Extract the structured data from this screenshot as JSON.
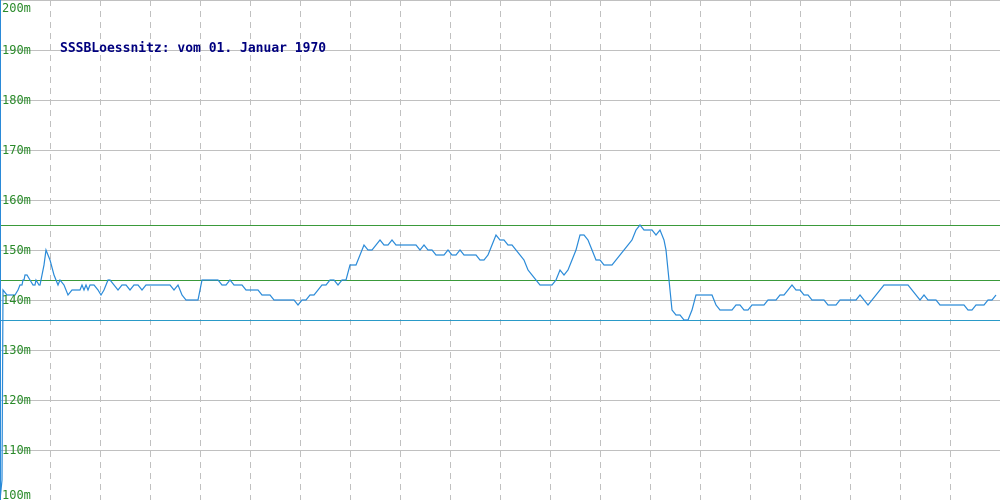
{
  "chart_data": {
    "type": "line",
    "title": "SSSBLoessnitz: vom 01. Januar 1970",
    "xlabel": "",
    "ylabel": "",
    "ylim": [
      100,
      200
    ],
    "yticks": [
      100,
      110,
      120,
      130,
      140,
      150,
      160,
      170,
      180,
      190,
      200
    ],
    "ytick_labels": [
      "100m",
      "110m",
      "120m",
      "130m",
      "140m",
      "150m",
      "160m",
      "170m",
      "180m",
      "190m",
      "200m"
    ],
    "grid": true,
    "x": [
      0,
      2,
      3,
      7,
      9,
      10,
      15,
      18,
      20,
      22,
      23,
      24,
      25,
      27,
      30,
      33,
      35,
      36,
      39,
      40,
      42,
      44,
      46,
      50,
      54,
      58,
      60,
      64,
      68,
      72,
      74,
      76,
      78,
      80,
      82,
      84,
      86,
      88,
      90,
      94,
      98,
      101,
      104,
      108,
      110,
      114,
      118,
      122,
      126,
      130,
      134,
      138,
      142,
      146,
      150,
      154,
      158,
      162,
      166,
      170,
      174,
      178,
      180,
      182,
      186,
      190,
      194,
      198,
      202,
      206,
      210,
      214,
      218,
      222,
      226,
      230,
      234,
      238,
      242,
      246,
      250,
      254,
      258,
      262,
      266,
      270,
      274,
      278,
      282,
      286,
      290,
      294,
      298,
      302,
      306,
      310,
      314,
      318,
      322,
      326,
      330,
      334,
      338,
      342,
      346,
      350,
      352,
      356,
      360,
      364,
      368,
      372,
      376,
      380,
      384,
      388,
      392,
      396,
      400,
      404,
      408,
      412,
      416,
      420,
      424,
      428,
      432,
      436,
      440,
      444,
      448,
      452,
      456,
      460,
      464,
      468,
      472,
      476,
      480,
      484,
      488,
      492,
      496,
      500,
      504,
      508,
      512,
      516,
      520,
      524,
      528,
      532,
      536,
      540,
      544,
      548,
      552,
      556,
      560,
      564,
      568,
      572,
      576,
      580,
      584,
      588,
      592,
      596,
      600,
      604,
      608,
      612,
      616,
      620,
      624,
      628,
      632,
      636,
      640,
      644,
      648,
      652,
      656,
      660,
      664,
      666,
      668,
      670,
      672,
      676,
      680,
      684,
      688,
      692,
      696,
      700,
      704,
      708,
      712,
      716,
      720,
      724,
      728,
      732,
      736,
      740,
      744,
      748,
      752,
      756,
      760,
      764,
      768,
      772,
      776,
      780,
      784,
      788,
      792,
      796,
      800,
      804,
      808,
      812,
      816,
      820,
      824,
      828,
      832,
      836,
      840,
      844,
      848,
      852,
      856,
      860,
      864,
      868,
      872,
      876,
      880,
      884,
      888,
      892,
      896,
      900,
      904,
      908,
      912,
      916,
      920,
      924,
      928,
      932,
      936,
      940,
      944,
      948,
      952,
      956,
      960,
      964,
      968,
      972,
      976,
      980,
      984,
      988,
      992,
      996
    ],
    "series": [
      {
        "values": [
          100,
          104,
          142,
          141,
          141,
          141,
          141,
          142,
          143,
          143,
          144,
          144,
          145,
          145,
          144,
          143,
          143,
          144,
          143,
          143,
          145,
          147,
          150,
          148,
          145,
          143,
          144,
          143,
          141,
          142,
          142,
          142,
          142,
          142,
          143,
          142,
          143,
          142,
          143,
          143,
          142,
          141,
          142,
          144,
          144,
          143,
          142,
          143,
          143,
          142,
          143,
          143,
          142,
          143,
          143,
          143,
          143,
          143,
          143,
          143,
          142,
          143,
          142,
          141,
          140,
          140,
          140,
          140,
          144,
          144,
          144,
          144,
          144,
          143,
          143,
          144,
          143,
          143,
          143,
          142,
          142,
          142,
          142,
          141,
          141,
          141,
          140,
          140,
          140,
          140,
          140,
          140,
          139,
          140,
          140,
          141,
          141,
          142,
          143,
          143,
          144,
          144,
          143,
          144,
          144,
          147,
          147,
          147,
          149,
          151,
          150,
          150,
          151,
          152,
          151,
          151,
          152,
          151,
          151,
          151,
          151,
          151,
          151,
          150,
          151,
          150,
          150,
          149,
          149,
          149,
          150,
          149,
          149,
          150,
          149,
          149,
          149,
          149,
          148,
          148,
          149,
          151,
          153,
          152,
          152,
          151,
          151,
          150,
          149,
          148,
          146,
          145,
          144,
          143,
          143,
          143,
          143,
          144,
          146,
          145,
          146,
          148,
          150,
          153,
          153,
          152,
          150,
          148,
          148,
          147,
          147,
          147,
          148,
          149,
          150,
          151,
          152,
          154,
          155,
          154,
          154,
          154,
          153,
          154,
          152,
          150,
          146,
          142,
          138,
          137,
          137,
          136,
          136,
          138,
          141,
          141,
          141,
          141,
          141,
          139,
          138,
          138,
          138,
          138,
          139,
          139,
          138,
          138,
          139,
          139,
          139,
          139,
          140,
          140,
          140,
          141,
          141,
          142,
          143,
          142,
          142,
          141,
          141,
          140,
          140,
          140,
          140,
          139,
          139,
          139,
          140,
          140,
          140,
          140,
          140,
          141,
          140,
          139,
          140,
          141,
          142,
          143,
          143,
          143,
          143,
          143,
          143,
          143,
          142,
          141,
          140,
          141,
          140,
          140,
          140,
          139,
          139,
          139,
          139,
          139,
          139,
          139,
          138,
          138,
          139,
          139,
          139,
          140,
          140,
          141,
          141,
          142,
          143,
          143
        ]
      }
    ],
    "hlines": [
      {
        "value": 155,
        "color": "#3a9a3a"
      },
      {
        "value": 144,
        "color": "#3a9a3a"
      },
      {
        "value": 136,
        "color": "#2a9ac8"
      }
    ],
    "colors": {
      "series": "#2a8ad8",
      "grid": "#c0c0c0",
      "tick_text": "#2a8a2a",
      "title_text": "#00007f",
      "axis": "#2a8ad8"
    }
  }
}
